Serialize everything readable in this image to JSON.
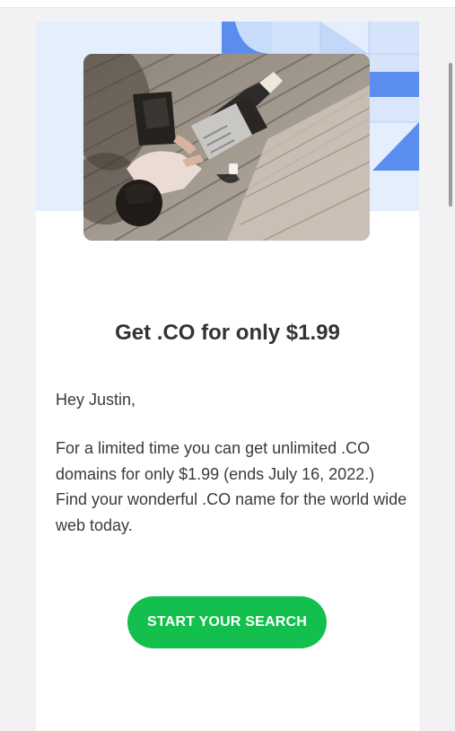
{
  "email": {
    "headline": "Get .CO for only $1.99",
    "greeting": "Hey Justin,",
    "body": "For a limited time you can get unlimited .CO domains for only $1.99 (ends July 16, 2022.) Find your wonderful .CO name for the world wide web today.",
    "cta_label": "START YOUR SEARCH"
  },
  "colors": {
    "hero_background": "#e4eefc",
    "accent_blue": "#5b8def",
    "cta_green": "#13c04d",
    "text": "#3b3b3b"
  },
  "hero": {
    "image": "photo-person-working-on-laptop-on-wooden-deck"
  }
}
